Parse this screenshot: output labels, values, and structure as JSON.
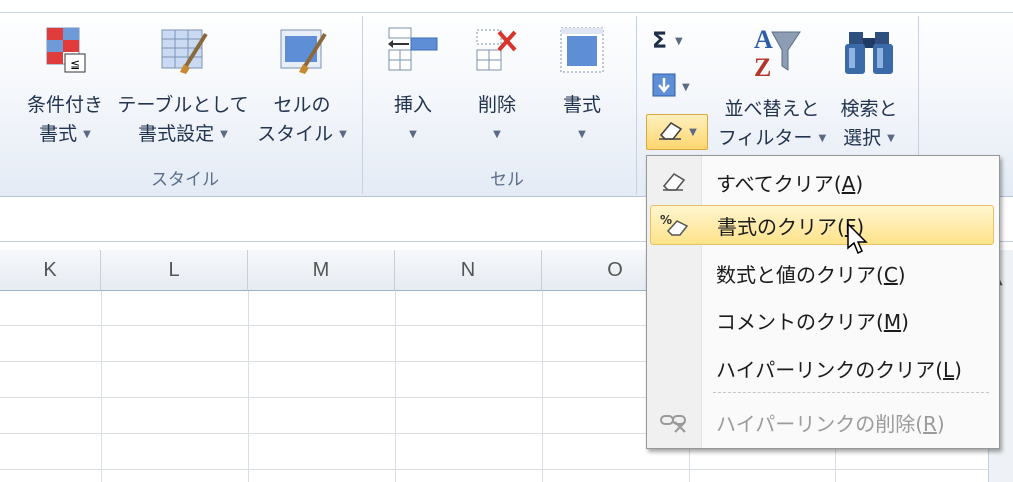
{
  "ribbon": {
    "styles_group": {
      "label": "スタイル",
      "conditional_format": {
        "line1": "条件付き",
        "line2": "書式"
      },
      "format_as_table": {
        "line1": "テーブルとして",
        "line2": "書式設定"
      },
      "cell_styles": {
        "line1": "セルの",
        "line2": "スタイル"
      }
    },
    "cells_group": {
      "label": "セル",
      "insert": "挿入",
      "delete": "削除",
      "format": "書式"
    },
    "editing_group": {
      "autosum_symbol": "Σ",
      "sort_filter": {
        "line1": "並べ替えと",
        "line2": "フィルター"
      },
      "find_select": {
        "line1": "検索と",
        "line2": "選択"
      }
    }
  },
  "columns": [
    "K",
    "L",
    "M",
    "N",
    "O"
  ],
  "clear_menu": {
    "items": [
      {
        "label": "すべてクリア",
        "key": "A"
      },
      {
        "label": "書式のクリア",
        "key": "F"
      },
      {
        "label": "数式と値のクリア",
        "key": "C"
      },
      {
        "label": "コメントのクリア",
        "key": "M"
      },
      {
        "label": "ハイパーリンクのクリア",
        "key": "L"
      },
      {
        "label": "ハイパーリンクの削除",
        "key": "R"
      }
    ]
  },
  "colors": {
    "accent": "#ffe38a",
    "ribbon_text": "#23344f",
    "disabled": "#9b9b9b"
  }
}
